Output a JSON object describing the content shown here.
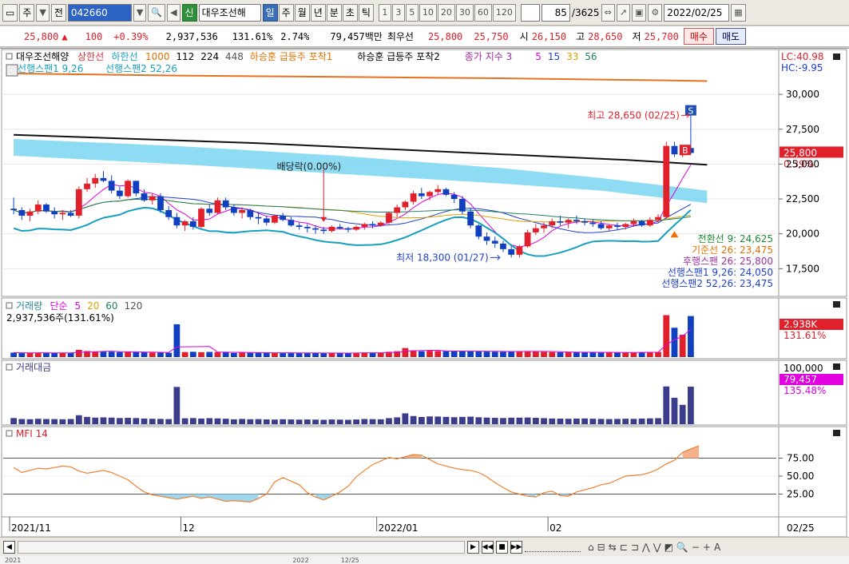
{
  "toolbar": {
    "menu_icon": "▭",
    "type_label": "주",
    "type_arrow": "▼",
    "scope_label": "전",
    "code_input": "042660",
    "code_arrow": "▼",
    "search_icon": "🔍",
    "sound_icon": "◀",
    "credit_label": "신",
    "stock_name": "대우조선해",
    "periods": [
      "일",
      "주",
      "월",
      "년",
      "분",
      "초",
      "틱"
    ],
    "active_period": "일",
    "intervals": [
      "1",
      "3",
      "5",
      "10",
      "20",
      "30",
      "60",
      "120"
    ],
    "count": "85",
    "count_total": "/3625",
    "date": "2022/02/25"
  },
  "quote": {
    "price": "25,800",
    "direction": "▲",
    "change": "100",
    "change_pct": "+0.39%",
    "volume": "2,937,536",
    "volume_ratio": "131.61%",
    "turnover": "2.74%",
    "trade_value": "79,457백만",
    "preferred_label": "최우선",
    "ask": "25,800",
    "bid": "25,750",
    "open_label": "시",
    "open": "26,150",
    "high_label": "고",
    "high": "28,650",
    "low_label": "저",
    "low": "25,700",
    "buy_button": "매수",
    "sell_button": "매도"
  },
  "price_panel": {
    "legend": [
      {
        "text": "대우조선해양",
        "color": "#000000"
      },
      {
        "text": "상한선",
        "color": "#e0303a"
      },
      {
        "text": "하한선",
        "color": "#16a0c0"
      },
      {
        "text": "1000",
        "color": "#e07000"
      },
      {
        "text": "112",
        "color": "#000000"
      },
      {
        "text": "224",
        "color": "#000000"
      },
      {
        "text": "448",
        "color": "#555555"
      },
      {
        "text": "하승훈 급등주 포착1",
        "color": "#e07000"
      },
      {
        "text": "하승훈 급등주 포착2",
        "color": "#000000"
      },
      {
        "text": "종가 지수 3",
        "color": "#a030a0"
      },
      {
        "text": "5",
        "color": "#e000e0"
      },
      {
        "text": "15",
        "color": "#2040d0"
      },
      {
        "text": "33",
        "color": "#e0a000"
      },
      {
        "text": "56",
        "color": "#208060"
      }
    ],
    "legend2": [
      {
        "text": "선행스팬1 9,26",
        "color": "#16a0c0"
      },
      {
        "text": "선행스팬2 52,26",
        "color": "#16a0c0"
      }
    ],
    "lc": "LC:40.98",
    "hc": "HC:-9.95",
    "y_ticks": [
      "30,000",
      "27,500",
      "25,000",
      "22,500",
      "20,000",
      "17,500"
    ],
    "price_tag": "25,800",
    "price_tag_pct": "0.39%",
    "high_annot": "최고 28,650 (02/25)",
    "low_annot": "최저 18,300 (01/27)",
    "dividend_annot": "배당락(0.00%)",
    "markers": {
      "s": "S",
      "b": "B"
    },
    "ichimoku": [
      {
        "text": "전환선 9: 24,625",
        "color": "#1a8a30"
      },
      {
        "text": "기준선 26: 23,475",
        "color": "#e07000"
      },
      {
        "text": "후행스팬 26: 25,800",
        "color": "#a030a0"
      },
      {
        "text": "선행스팬1 9,26: 24,050",
        "color": "#2040d0"
      },
      {
        "text": "선행스팬2 52,26: 23,475",
        "color": "#2040d0"
      }
    ]
  },
  "volume_panel": {
    "legend": [
      {
        "text": "거래량",
        "color": "#2a8a9a"
      },
      {
        "text": "단순",
        "color": "#e000e0"
      },
      {
        "text": "5",
        "color": "#e000e0"
      },
      {
        "text": "20",
        "color": "#e0a000"
      },
      {
        "text": "60",
        "color": "#208060"
      },
      {
        "text": "120",
        "color": "#555555"
      }
    ],
    "value": "2,937,536주(131.61%)",
    "tag": "2.938K",
    "tag_pct": "131.61%"
  },
  "amount_panel": {
    "title": "거래대금",
    "y_tick": "100,000",
    "tag": "79,457",
    "tag_pct": "135.48%"
  },
  "mfi_panel": {
    "title": "MFI 14",
    "y_ticks": [
      "75.00",
      "50.00",
      "25.00"
    ]
  },
  "x_axis": {
    "labels": [
      "2021/11",
      "12",
      "2022/01",
      "02"
    ],
    "right_label": "02/25"
  },
  "bottom": {
    "left_arrow": "◀",
    "right_icons": [
      "⌂",
      "⊟",
      "⇆",
      "⊏",
      "⊐",
      "⋀",
      "⋁",
      "◩",
      "🔍",
      "−",
      "+",
      "A"
    ]
  },
  "status": [
    "2021",
    "2022",
    "12/25"
  ],
  "chart_data": [
    {
      "type": "candlestick",
      "title": "대우조선해양",
      "ylim": [
        15800,
        32700
      ],
      "candles": [
        [
          21800,
          22600,
          21400,
          21700
        ],
        [
          21700,
          21900,
          21000,
          21300
        ],
        [
          21300,
          21800,
          20900,
          21600
        ],
        [
          21600,
          22400,
          21400,
          22100
        ],
        [
          22100,
          22200,
          21500,
          21600
        ],
        [
          21600,
          21900,
          21100,
          21400
        ],
        [
          21400,
          21700,
          21000,
          21500
        ],
        [
          21500,
          21700,
          21200,
          21300
        ],
        [
          21300,
          23400,
          21100,
          23200
        ],
        [
          23200,
          24000,
          23000,
          23600
        ],
        [
          23600,
          24300,
          23300,
          24000
        ],
        [
          24000,
          24500,
          23700,
          23800
        ],
        [
          23800,
          24200,
          22900,
          23100
        ],
        [
          23100,
          23400,
          22500,
          22700
        ],
        [
          22700,
          23900,
          22600,
          23800
        ],
        [
          23800,
          23800,
          22700,
          22900
        ],
        [
          22900,
          23200,
          22300,
          22400
        ],
        [
          22400,
          22900,
          22100,
          22700
        ],
        [
          22700,
          22900,
          21500,
          21700
        ],
        [
          21700,
          22000,
          21000,
          21200
        ],
        [
          21200,
          21500,
          20400,
          20600
        ],
        [
          20600,
          21000,
          20200,
          20900
        ],
        [
          20900,
          21200,
          20300,
          20500
        ],
        [
          20500,
          21900,
          20400,
          21800
        ],
        [
          21800,
          22100,
          21300,
          21500
        ],
        [
          21500,
          22600,
          21400,
          22400
        ],
        [
          22400,
          22600,
          21700,
          21900
        ],
        [
          21900,
          22100,
          21300,
          21500
        ],
        [
          21500,
          21900,
          21100,
          21700
        ],
        [
          21700,
          21800,
          21000,
          21200
        ],
        [
          21200,
          21500,
          20700,
          21100
        ],
        [
          21100,
          21300,
          20600,
          20800
        ],
        [
          20800,
          21400,
          20700,
          21300
        ],
        [
          21300,
          21500,
          20900,
          21000
        ],
        [
          21000,
          21200,
          20500,
          20600
        ],
        [
          20600,
          20800,
          20300,
          20500
        ],
        [
          20500,
          20700,
          20100,
          20400
        ],
        [
          20400,
          20600,
          20000,
          20300
        ],
        [
          20300,
          20500,
          20000,
          20200
        ],
        [
          20200,
          20600,
          20100,
          20500
        ],
        [
          20500,
          20700,
          20300,
          20400
        ],
        [
          20400,
          20500,
          20100,
          20300
        ],
        [
          20300,
          20600,
          20200,
          20500
        ],
        [
          20500,
          20800,
          20300,
          20700
        ],
        [
          20700,
          20900,
          20400,
          20600
        ],
        [
          20600,
          20900,
          20500,
          20800
        ],
        [
          20800,
          21600,
          20700,
          21500
        ],
        [
          21500,
          22100,
          21200,
          21900
        ],
        [
          21900,
          22400,
          21700,
          22300
        ],
        [
          22300,
          23100,
          22100,
          22900
        ],
        [
          22900,
          23300,
          22500,
          22700
        ],
        [
          22700,
          23100,
          22400,
          23000
        ],
        [
          23000,
          23500,
          22800,
          23200
        ],
        [
          23200,
          23300,
          22700,
          22800
        ],
        [
          22800,
          23000,
          22200,
          22500
        ],
        [
          22500,
          22700,
          21400,
          21600
        ],
        [
          21600,
          21800,
          20400,
          20600
        ],
        [
          20600,
          20700,
          19600,
          19800
        ],
        [
          19800,
          20100,
          19200,
          19500
        ],
        [
          19500,
          19800,
          19000,
          19300
        ],
        [
          19300,
          19500,
          18700,
          18900
        ],
        [
          18900,
          19100,
          18300,
          18500
        ],
        [
          18500,
          19200,
          18300,
          19100
        ],
        [
          19100,
          20300,
          19000,
          20100
        ],
        [
          20100,
          20700,
          19900,
          20400
        ],
        [
          20400,
          20800,
          20100,
          20600
        ],
        [
          20600,
          21100,
          20400,
          20900
        ],
        [
          20900,
          21300,
          20600,
          20800
        ],
        [
          20800,
          21100,
          20400,
          21000
        ],
        [
          21000,
          21300,
          20700,
          20900
        ],
        [
          20900,
          21100,
          20600,
          20800
        ],
        [
          20800,
          21000,
          20500,
          20700
        ],
        [
          20700,
          20900,
          20300,
          20400
        ],
        [
          20400,
          20700,
          20200,
          20600
        ],
        [
          20600,
          20800,
          20300,
          20500
        ],
        [
          20500,
          20800,
          20300,
          20700
        ],
        [
          20700,
          21100,
          20500,
          20900
        ],
        [
          20900,
          21000,
          20500,
          20600
        ],
        [
          20600,
          21200,
          20500,
          21000
        ],
        [
          21000,
          21400,
          20800,
          21200
        ],
        [
          21200,
          26600,
          21100,
          26300
        ],
        [
          26300,
          26600,
          25500,
          25700
        ],
        [
          25700,
          26200,
          25500,
          25700
        ],
        [
          26150,
          28650,
          25700,
          25800
        ]
      ],
      "ma_long_orange": [
        [
          0,
          31500
        ],
        [
          20,
          31350
        ],
        [
          40,
          31250
        ],
        [
          60,
          31150
        ],
        [
          80,
          31000
        ],
        [
          85,
          30950
        ]
      ],
      "ma_black": [
        [
          0,
          27100
        ],
        [
          15,
          26800
        ],
        [
          30,
          26500
        ],
        [
          45,
          26100
        ],
        [
          60,
          25700
        ],
        [
          75,
          25300
        ],
        [
          85,
          24950
        ]
      ],
      "cloud_upper": [
        [
          0,
          26800
        ],
        [
          20,
          26300
        ],
        [
          40,
          25600
        ],
        [
          60,
          24700
        ],
        [
          72,
          24000
        ],
        [
          85,
          23100
        ]
      ],
      "cloud_lower": [
        [
          0,
          25600
        ],
        [
          20,
          25000
        ],
        [
          40,
          24300
        ],
        [
          60,
          23600
        ],
        [
          72,
          23100
        ],
        [
          85,
          22200
        ]
      ]
    },
    {
      "type": "bar",
      "title": "거래량",
      "ylim": [
        0,
        3200000
      ],
      "values": [
        320000,
        300000,
        290000,
        310000,
        300000,
        305000,
        295000,
        300000,
        520000,
        430000,
        380000,
        400000,
        390000,
        360000,
        380000,
        360000,
        340000,
        330000,
        320000,
        310000,
        2350000,
        360000,
        380000,
        350000,
        370000,
        360000,
        340000,
        300000,
        330000,
        310000,
        320000,
        300000,
        290000,
        310000,
        300000,
        290000,
        300000,
        290000,
        280000,
        300000,
        290000,
        280000,
        300000,
        330000,
        320000,
        310000,
        380000,
        420000,
        650000,
        480000,
        420000,
        450000,
        440000,
        420000,
        400000,
        420000,
        440000,
        410000,
        400000,
        390000,
        380000,
        410000,
        420000,
        430000,
        400000,
        380000,
        360000,
        350000,
        340000,
        350000,
        360000,
        340000,
        330000,
        320000,
        330000,
        340000,
        330000,
        350000,
        360000,
        370000,
        3000000,
        2100000,
        1600000,
        2940000
      ]
    },
    {
      "type": "bar",
      "title": "거래대금",
      "ylim": [
        0,
        110000
      ],
      "values": [
        13000,
        11000,
        10500,
        11500,
        11000,
        10800,
        10500,
        11000,
        19000,
        15500,
        14000,
        14500,
        14000,
        13000,
        13500,
        13000,
        12000,
        11500,
        11200,
        10800,
        79000,
        12500,
        13000,
        12000,
        12800,
        12300,
        11600,
        10300,
        11200,
        10500,
        10800,
        10100,
        9800,
        10500,
        10100,
        9700,
        10000,
        9700,
        9300,
        10000,
        9700,
        9300,
        10000,
        11000,
        10700,
        10400,
        12800,
        14500,
        23000,
        17300,
        15300,
        16500,
        16200,
        15500,
        14800,
        15500,
        16000,
        14700,
        14000,
        13500,
        13000,
        13800,
        13900,
        14200,
        13500,
        12800,
        12100,
        11800,
        11500,
        11900,
        12200,
        11600,
        11200,
        10900,
        11200,
        11600,
        11300,
        12000,
        12400,
        12800,
        80000,
        56000,
        41000,
        79457
      ]
    },
    {
      "type": "line",
      "title": "MFI 14",
      "ylim": [
        0,
        100
      ],
      "values": [
        62,
        55,
        58,
        61,
        60,
        62,
        64,
        63,
        57,
        54,
        56,
        58,
        55,
        50,
        45,
        36,
        28,
        24,
        22,
        20,
        18,
        20,
        22,
        19,
        21,
        18,
        15,
        16,
        15,
        14,
        19,
        25,
        42,
        48,
        43,
        38,
        27,
        21,
        17,
        22,
        28,
        36,
        49,
        58,
        66,
        71,
        76,
        74,
        77,
        80,
        79,
        73,
        67,
        64,
        61,
        59,
        58,
        55,
        49,
        41,
        34,
        28,
        25,
        22,
        21,
        27,
        29,
        23,
        22,
        28,
        31,
        34,
        38,
        40,
        45,
        50,
        51,
        52,
        55,
        60,
        67,
        72,
        83,
        88,
        92
      ],
      "bands": [
        75,
        25
      ]
    }
  ]
}
